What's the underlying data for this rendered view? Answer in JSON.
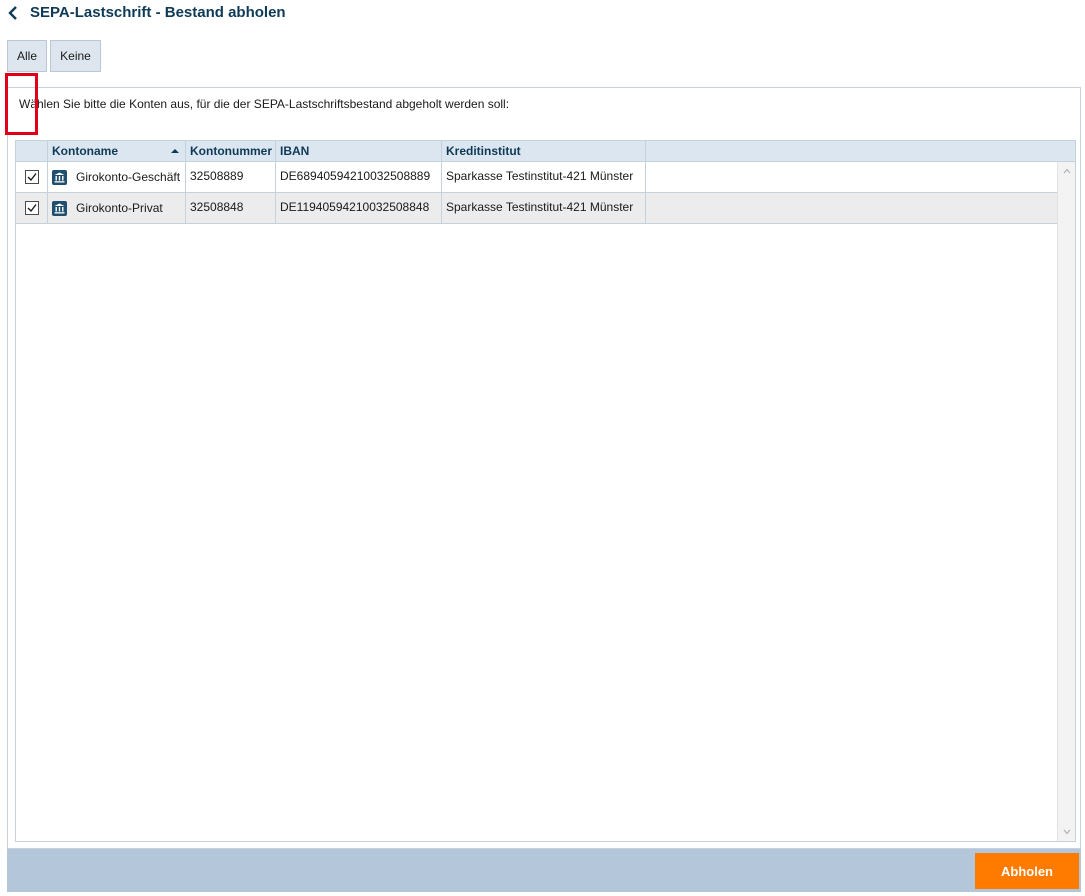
{
  "header": {
    "title": "SEPA-Lastschrift - Bestand abholen",
    "back_icon": "chevron-left-icon"
  },
  "selection": {
    "all_label": "Alle",
    "none_label": "Keine"
  },
  "instruction": "Wählen Sie bitte die Konten aus, für die der SEPA-Lastschriftsbestand abgeholt werden soll:",
  "table": {
    "columns": [
      "Kontoname",
      "Kontonummer",
      "IBAN",
      "Kreditinstitut"
    ],
    "sort_column": "Kontoname",
    "sort_direction": "ascending",
    "rows": [
      {
        "checked": true,
        "icon": "bank-icon",
        "name": "Girokonto-Geschäft",
        "number": "32508889",
        "iban": "DE68940594210032508889",
        "bank": "Sparkasse Testinstitut-421 Münster"
      },
      {
        "checked": true,
        "icon": "bank-icon",
        "name": "Girokonto-Privat",
        "number": "32508848",
        "iban": "DE11940594210032508848",
        "bank": "Sparkasse Testinstitut-421 Münster"
      }
    ]
  },
  "footer": {
    "fetch_label": "Abholen"
  },
  "colors": {
    "title": "#0f3a55",
    "header_bg": "#dce6f0",
    "footer_bg": "#b4c6d9",
    "accent": "#ff7b00",
    "highlight": "#e0001b"
  }
}
